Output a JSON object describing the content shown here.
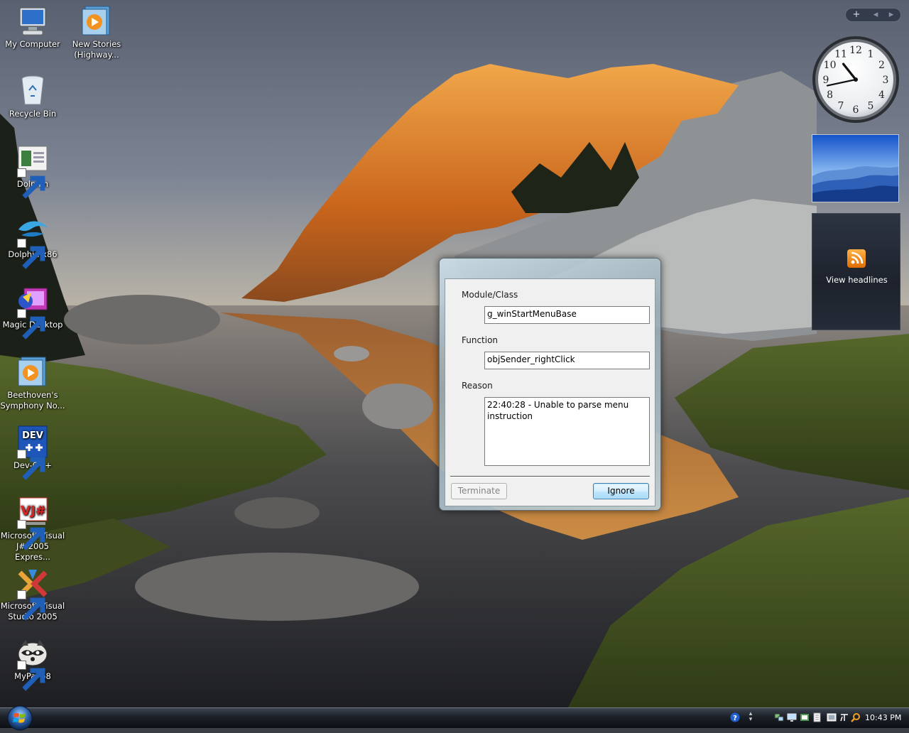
{
  "desktop": {
    "icons": [
      {
        "label": "My Computer",
        "icon": "computer-icon",
        "shortcut": false
      },
      {
        "label": "New Stories (Highway...",
        "icon": "media-file-icon",
        "shortcut": false
      },
      {
        "label": "Recycle Bin",
        "icon": "recycle-bin-icon",
        "shortcut": false
      },
      {
        "label": "Dolphin",
        "icon": "dolphin-window-icon",
        "shortcut": true
      },
      {
        "label": "Dolphin x86",
        "icon": "dolphin-icon",
        "shortcut": true
      },
      {
        "label": "Magic Desktop",
        "icon": "magic-desktop-icon",
        "shortcut": true
      },
      {
        "label": "Beethoven's Symphony No...",
        "icon": "media-file-icon",
        "shortcut": false
      },
      {
        "label": "Dev-C++",
        "icon": "dev-cpp-icon",
        "shortcut": true
      },
      {
        "label": "Microsoft Visual J# 2005 Expres...",
        "icon": "visual-jsharp-icon",
        "shortcut": true
      },
      {
        "label": "Microsoft Visual Studio 2005",
        "icon": "visual-studio-icon",
        "shortcut": true
      },
      {
        "label": "MyPal 68",
        "icon": "mypal-raccoon-icon",
        "shortcut": true
      }
    ]
  },
  "sidebar": {
    "controls": {
      "add": "+",
      "prev": "◂",
      "next": "▸"
    },
    "clock": {
      "hour": 10,
      "minute": 43,
      "numerals": [
        "12",
        "1",
        "2",
        "3",
        "4",
        "5",
        "6",
        "7",
        "8",
        "9",
        "10",
        "11"
      ]
    },
    "feed": {
      "label": "View headlines",
      "icon": "rss-feed-icon"
    }
  },
  "dialog": {
    "module_label": "Module/Class",
    "module_value": "g_winStartMenuBase",
    "function_label": "Function",
    "function_value": "objSender_rightClick",
    "reason_label": "Reason",
    "reason_value": "22:40:28 - Unable to parse menu instruction",
    "terminate_label": "Terminate",
    "ignore_label": "Ignore"
  },
  "taskbar": {
    "start_icon": "windows-start-orb-icon",
    "tray_icons": [
      "help-icon",
      "network-icon",
      "display-icon",
      "volume-icon",
      "document-icon",
      "clipboard-icon",
      "language-icon",
      "search-icon"
    ],
    "time": "10:43 PM"
  },
  "colors": {
    "sky_top": "#5c6371",
    "sky_horizon": "#c8bba6",
    "mountain_lit": "#e08a2c",
    "accent_button": "#3c7fb1"
  }
}
